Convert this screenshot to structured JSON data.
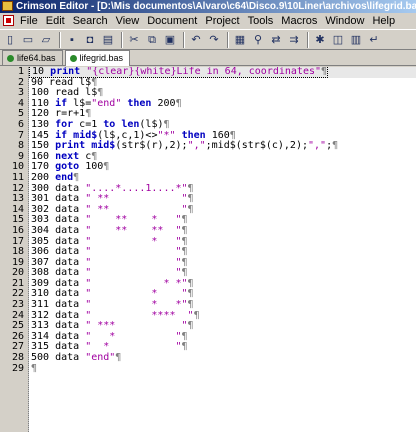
{
  "window": {
    "title": "Crimson Editor - [D:\\Mis documentos\\Alvaro\\c64\\Disco.9\\10Liner\\archivos\\lifegrid.bas]"
  },
  "menu": [
    "File",
    "Edit",
    "Search",
    "View",
    "Document",
    "Project",
    "Tools",
    "Macros",
    "Window",
    "Help"
  ],
  "toolbar": {
    "icons": [
      "new-icon",
      "open-icon",
      "open-folder-icon",
      "save-icon",
      "save-all-icon",
      "print-icon",
      "cut-icon",
      "copy-icon",
      "paste-icon",
      "undo-icon",
      "redo-icon",
      "find-box-icon",
      "find-icon",
      "replace-icon",
      "find-next-icon",
      "tools-icon",
      "window-icon",
      "screen-icon",
      "word-wrap-icon"
    ]
  },
  "tabs": [
    {
      "label": "life64.bas",
      "active": false
    },
    {
      "label": "lifegrid.bas",
      "active": true
    }
  ],
  "colors": {
    "keyword": "#0000c0",
    "string": "#a000a0",
    "title_start": "#0a246a"
  },
  "lines": [
    {
      "n": "1",
      "segs": [
        [
          "n",
          "10 "
        ],
        [
          "k",
          "print"
        ],
        [
          "n",
          " "
        ],
        [
          "s",
          "\"{clear}{white}Life in 64, coordinates\""
        ]
      ]
    },
    {
      "n": "2",
      "segs": [
        [
          "n",
          "90 read l$"
        ]
      ]
    },
    {
      "n": "3",
      "segs": [
        [
          "n",
          "100 read l$"
        ]
      ]
    },
    {
      "n": "4",
      "segs": [
        [
          "n",
          "110 "
        ],
        [
          "k",
          "if"
        ],
        [
          "n",
          " l$="
        ],
        [
          "s",
          "\"end\""
        ],
        [
          "n",
          " "
        ],
        [
          "k",
          "then"
        ],
        [
          "n",
          " 200"
        ]
      ]
    },
    {
      "n": "5",
      "segs": [
        [
          "n",
          "120 r=r+1"
        ]
      ]
    },
    {
      "n": "6",
      "segs": [
        [
          "n",
          "130 "
        ],
        [
          "k",
          "for"
        ],
        [
          "n",
          " c=1 "
        ],
        [
          "k",
          "to"
        ],
        [
          "n",
          " "
        ],
        [
          "k",
          "len"
        ],
        [
          "n",
          "(l$)"
        ]
      ]
    },
    {
      "n": "7",
      "segs": [
        [
          "n",
          "145 "
        ],
        [
          "k",
          "if"
        ],
        [
          "n",
          " "
        ],
        [
          "k",
          "mid$"
        ],
        [
          "n",
          "(l$,c,1)<>"
        ],
        [
          "s",
          "\"*\""
        ],
        [
          "n",
          " "
        ],
        [
          "k",
          "then"
        ],
        [
          "n",
          " 160"
        ]
      ]
    },
    {
      "n": "8",
      "segs": [
        [
          "n",
          "150 "
        ],
        [
          "k",
          "print"
        ],
        [
          "n",
          " "
        ],
        [
          "k",
          "mid$"
        ],
        [
          "n",
          "(str$(r),2);"
        ],
        [
          "s",
          "\",\""
        ],
        [
          "n",
          ";mid$(str$(c),2);"
        ],
        [
          "s",
          "\",\""
        ],
        [
          "n",
          ";"
        ]
      ]
    },
    {
      "n": "9",
      "segs": [
        [
          "n",
          "160 "
        ],
        [
          "k",
          "next"
        ],
        [
          "n",
          " c"
        ]
      ]
    },
    {
      "n": "10",
      "segs": [
        [
          "n",
          "170 "
        ],
        [
          "k",
          "goto"
        ],
        [
          "n",
          " 100"
        ]
      ]
    },
    {
      "n": "11",
      "segs": [
        [
          "n",
          "200 "
        ],
        [
          "k",
          "end"
        ]
      ]
    },
    {
      "n": "12",
      "segs": [
        [
          "n",
          "300 data "
        ],
        [
          "s",
          "\"....*....1....*\""
        ]
      ]
    },
    {
      "n": "13",
      "segs": [
        [
          "n",
          "301 data "
        ],
        [
          "s",
          "\" **            \""
        ]
      ]
    },
    {
      "n": "14",
      "segs": [
        [
          "n",
          "302 data "
        ],
        [
          "s",
          "\" **            \""
        ]
      ]
    },
    {
      "n": "15",
      "segs": [
        [
          "n",
          "303 data "
        ],
        [
          "s",
          "\"    **    *   \""
        ]
      ]
    },
    {
      "n": "16",
      "segs": [
        [
          "n",
          "304 data "
        ],
        [
          "s",
          "\"    **    **  \""
        ]
      ]
    },
    {
      "n": "17",
      "segs": [
        [
          "n",
          "305 data "
        ],
        [
          "s",
          "\"          *   \""
        ]
      ]
    },
    {
      "n": "18",
      "segs": [
        [
          "n",
          "306 data "
        ],
        [
          "s",
          "\"              \""
        ]
      ]
    },
    {
      "n": "19",
      "segs": [
        [
          "n",
          "307 data "
        ],
        [
          "s",
          "\"              \""
        ]
      ]
    },
    {
      "n": "20",
      "segs": [
        [
          "n",
          "308 data "
        ],
        [
          "s",
          "\"              \""
        ]
      ]
    },
    {
      "n": "21",
      "segs": [
        [
          "n",
          "309 data "
        ],
        [
          "s",
          "\"            * *\""
        ]
      ]
    },
    {
      "n": "22",
      "segs": [
        [
          "n",
          "310 data "
        ],
        [
          "s",
          "\"          *    \""
        ]
      ]
    },
    {
      "n": "23",
      "segs": [
        [
          "n",
          "311 data "
        ],
        [
          "s",
          "\"          *   *\""
        ]
      ]
    },
    {
      "n": "24",
      "segs": [
        [
          "n",
          "312 data "
        ],
        [
          "s",
          "\"          ****  \""
        ]
      ]
    },
    {
      "n": "25",
      "segs": [
        [
          "n",
          "313 data "
        ],
        [
          "s",
          "\" ***           \""
        ]
      ]
    },
    {
      "n": "26",
      "segs": [
        [
          "n",
          "314 data "
        ],
        [
          "s",
          "\"   *          \""
        ]
      ]
    },
    {
      "n": "27",
      "segs": [
        [
          "n",
          "315 data "
        ],
        [
          "s",
          "\"  *           \""
        ]
      ]
    },
    {
      "n": "28",
      "segs": [
        [
          "n",
          "500 data "
        ],
        [
          "s",
          "\"end\""
        ]
      ]
    },
    {
      "n": "29",
      "segs": []
    }
  ],
  "eol_mark": "¶"
}
